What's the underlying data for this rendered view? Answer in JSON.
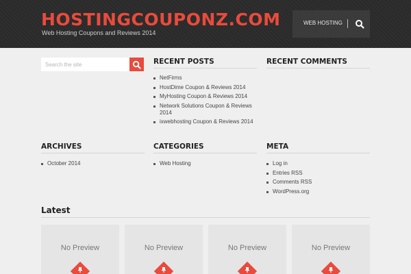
{
  "header": {
    "site_title": "HOSTINGCOUPONZ.COM",
    "tagline": "Web Hosting Coupons and Reviews 2014",
    "nav": {
      "link_label": "WEB HOSTING",
      "search_icon": "search-icon"
    }
  },
  "search": {
    "placeholder": "Search the site",
    "button_icon": "search-icon"
  },
  "widgets": {
    "recent_posts": {
      "title": "RECENT POSTS",
      "items": [
        "NetFirms",
        "HostDime Coupon & Reviews 2014",
        "MyHosting Coupon & Reviews 2014",
        "Network Solutions Coupon & Reviews 2014",
        "ixwebhosting Coupon & Reviews 2014"
      ]
    },
    "recent_comments": {
      "title": "RECENT COMMENTS"
    },
    "archives": {
      "title": "ARCHIVES",
      "items": [
        "October 2014"
      ]
    },
    "categories": {
      "title": "CATEGORIES",
      "items": [
        "Web Hosting"
      ]
    },
    "meta": {
      "title": "META",
      "items": [
        "Log in",
        "Entries RSS",
        "Comments RSS",
        "WordPress.org"
      ]
    }
  },
  "latest": {
    "title": "Latest",
    "cards": [
      {
        "label": "No Preview"
      },
      {
        "label": "No Preview"
      },
      {
        "label": "No Preview"
      },
      {
        "label": "No Preview"
      }
    ]
  },
  "colors": {
    "accent": "#e94b3c",
    "header_bg": "#2b2b2b",
    "page_bg": "#efefef"
  }
}
